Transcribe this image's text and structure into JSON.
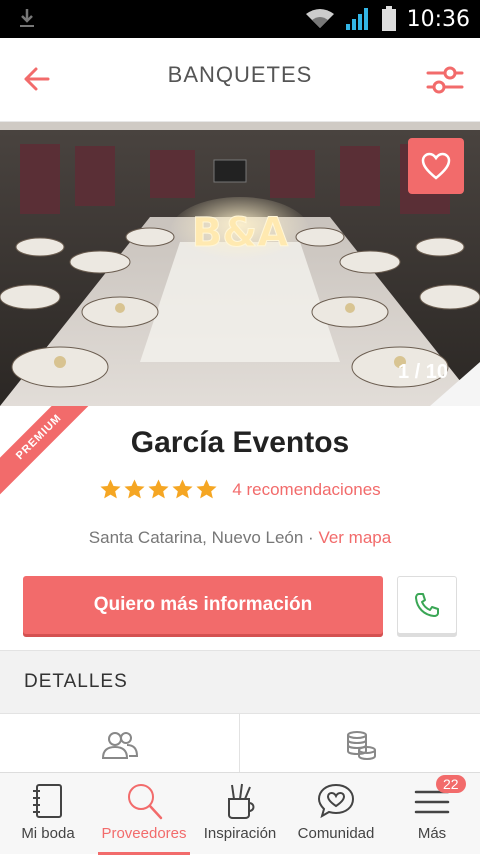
{
  "status_bar": {
    "time": "10:36"
  },
  "header": {
    "title": "BANQUETES"
  },
  "gallery": {
    "counter": "1 / 10"
  },
  "vendor": {
    "premium_label": "PREMIUM",
    "name": "García Eventos",
    "rating_stars": 5,
    "recommendations": "4 recomendaciones",
    "location": "Santa Catarina, Nuevo León · ",
    "map_link": "Ver mapa"
  },
  "actions": {
    "info_button": "Quiero más información"
  },
  "details": {
    "title": "DETALLES"
  },
  "nav": {
    "items": [
      {
        "label": "Mi boda"
      },
      {
        "label": "Proveedores"
      },
      {
        "label": "Inspiración"
      },
      {
        "label": "Comunidad"
      },
      {
        "label": "Más",
        "badge": "22"
      }
    ],
    "active_index": 1
  },
  "colors": {
    "accent": "#f26b6b",
    "call_green": "#3aa655"
  }
}
